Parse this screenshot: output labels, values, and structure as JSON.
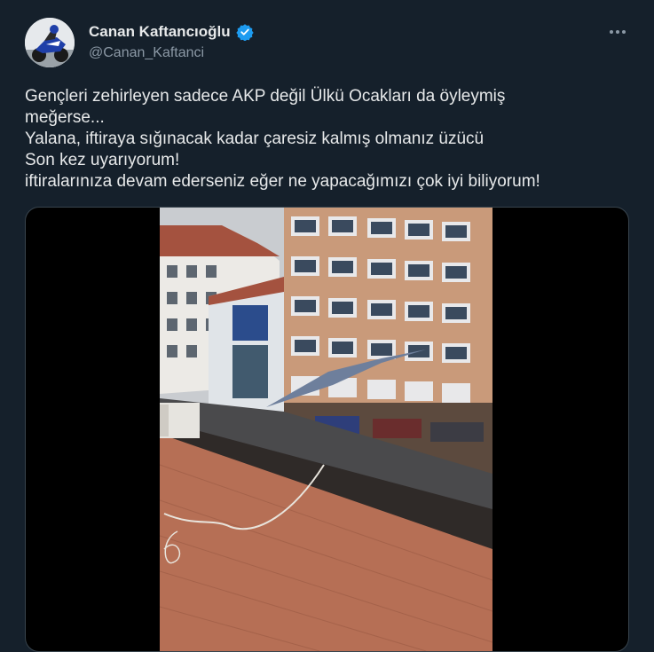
{
  "author": {
    "display_name": "Canan Kaftancıoğlu",
    "handle": "@Canan_Kaftanci",
    "verified": true
  },
  "tweet": {
    "lines": [
      "Gençleri zehirleyen sadece AKP değil Ülkü Ocakları da öyleymiş",
      "meğerse...",
      "Yalana, iftiraya sığınacak kadar çaresiz kalmış olmanız üzücü",
      "Son kez uyarıyorum!",
      "iftiralarınıza devam ederseniz eğer ne yapacağımızı çok iyi biliyorum!"
    ]
  },
  "icons": {
    "verified": "verified-badge-icon",
    "more": "more-options-icon"
  },
  "colors": {
    "background": "#15202b",
    "text": "#e7e9ea",
    "secondary_text": "#8b98a5",
    "verified_blue": "#1d9bf0",
    "border": "#38444d"
  }
}
